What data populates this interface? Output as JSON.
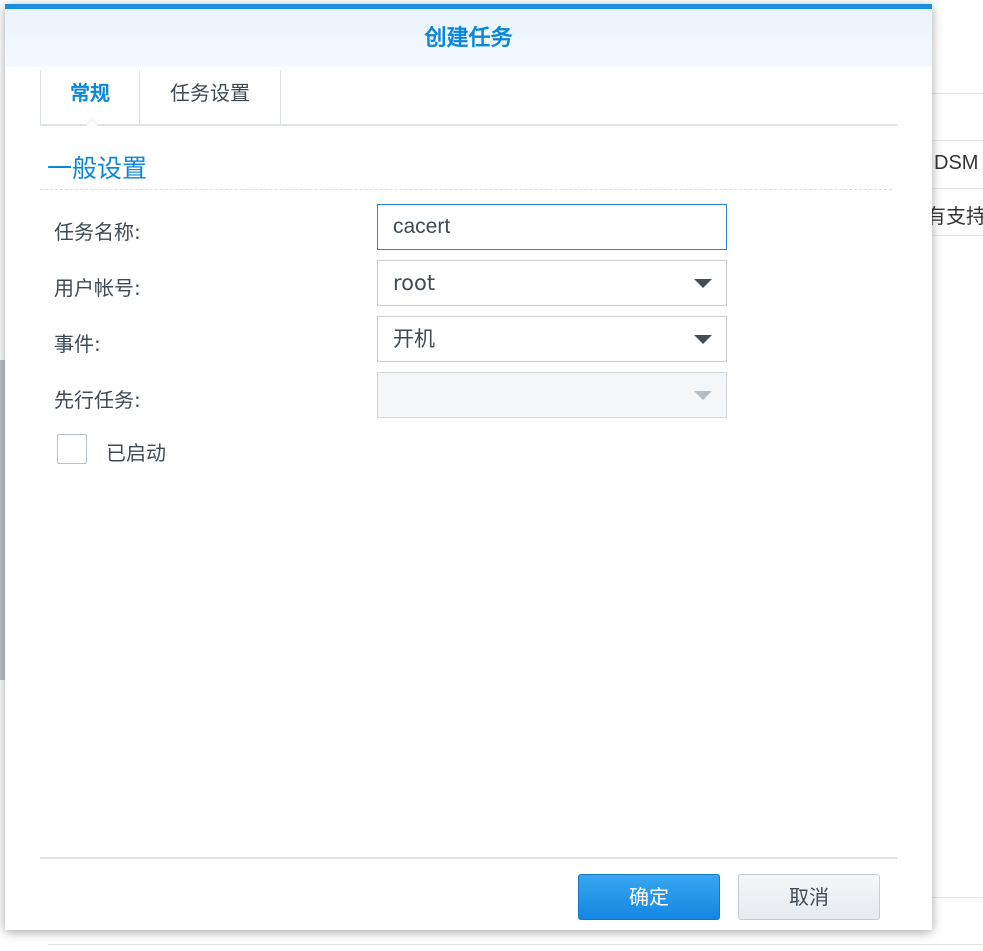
{
  "dialog": {
    "title": "创建任务",
    "tabs": [
      {
        "label": "常规",
        "active": true
      },
      {
        "label": "任务设置",
        "active": false
      }
    ],
    "section_title": "一般设置",
    "form": {
      "task_name_label": "任务名称:",
      "task_name_value": "cacert",
      "user_label": "用户帐号:",
      "user_value": "root",
      "event_label": "事件:",
      "event_value": "开机",
      "pre_task_label": "先行任务:",
      "pre_task_value": "",
      "enabled_label": "已启动",
      "enabled_checked": false
    },
    "buttons": {
      "ok": "确定",
      "cancel": "取消"
    }
  },
  "background": {
    "dsm_text": "DSM",
    "support_text": "有支持"
  },
  "colors": {
    "accent": "#0b86d9",
    "header_border": "#1a8ee3",
    "primary_button": "#1487e2"
  }
}
